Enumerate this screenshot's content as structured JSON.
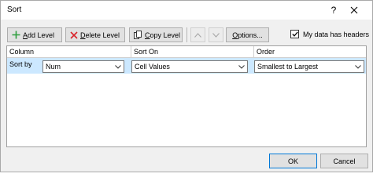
{
  "window": {
    "title": "Sort",
    "help_label": "?"
  },
  "toolbar": {
    "add_level_prefix": "",
    "add_level_mnemonic": "A",
    "add_level_rest": "dd Level",
    "delete_level_mnemonic": "D",
    "delete_level_rest": "elete Level",
    "copy_level_mnemonic": "C",
    "copy_level_rest": "opy Level",
    "options_mnemonic": "O",
    "options_rest": "ptions...",
    "headers_label": "My data has headers",
    "headers_mnemonic": "h",
    "headers_checked": true
  },
  "grid": {
    "columns": [
      "Column",
      "Sort On",
      "Order"
    ],
    "rows": [
      {
        "label": "Sort by",
        "column": "Num",
        "sort_on": "Cell Values",
        "order": "Smallest to Largest"
      }
    ]
  },
  "footer": {
    "ok_label": "OK",
    "cancel_label": "Cancel"
  },
  "colors": {
    "accent": "#0078d7",
    "selection": "#cce8ff",
    "add_icon": "#2e9e3e",
    "delete_icon": "#d9242b"
  },
  "icons": [
    "add-icon",
    "delete-icon",
    "copy-icon",
    "up-arrow-icon",
    "down-arrow-icon",
    "close-icon",
    "chevron-down-icon",
    "checkmark-icon"
  ]
}
